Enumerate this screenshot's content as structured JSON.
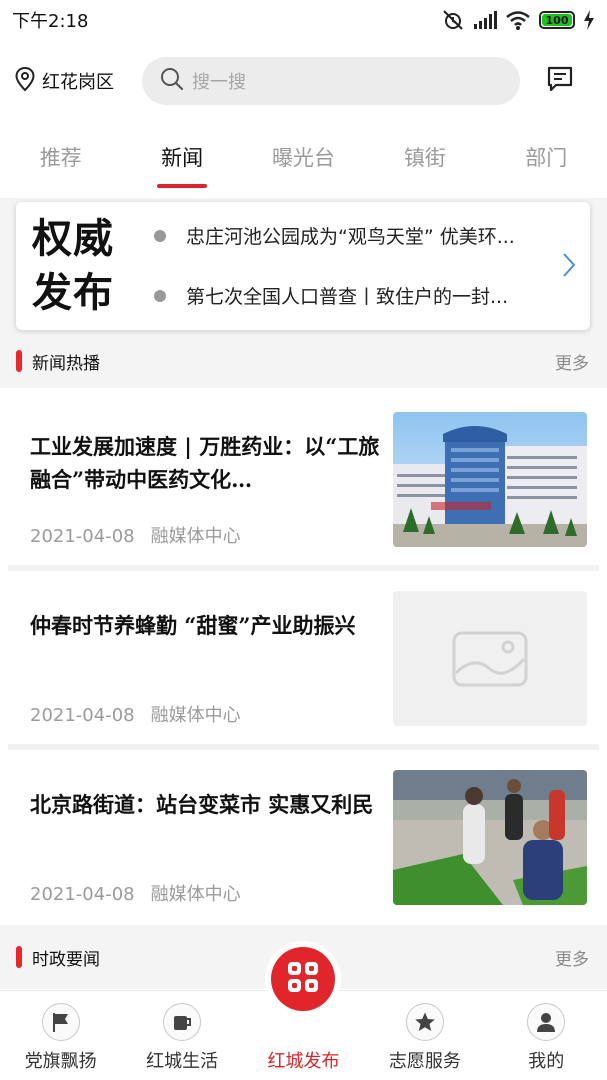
{
  "status_bar": {
    "time": "下午2:18",
    "battery": "100"
  },
  "header": {
    "location": "红花岗区",
    "search_placeholder": "搜一搜"
  },
  "tabs": [
    {
      "label": "推荐"
    },
    {
      "label": "新闻"
    },
    {
      "label": "曝光台"
    },
    {
      "label": "镇街"
    },
    {
      "label": "部门"
    }
  ],
  "active_tab": "新闻",
  "authority": {
    "title_line1": "权威",
    "title_line2": "发布",
    "items": [
      {
        "text": "忠庄河池公园成为“观鸟天堂” 优美环..."
      },
      {
        "text": "第七次全国人口普查丨致住户的一封..."
      }
    ]
  },
  "section_hot": {
    "title": "新闻热播",
    "more": "更多"
  },
  "news": [
    {
      "title": "工业发展加速度 | 万胜药业：以“工旅融合”带动中医药文化…",
      "date": "2021-04-08",
      "source": "融媒体中心"
    },
    {
      "title": "仲春时节养蜂勤 “甜蜜”产业助振兴",
      "date": "2021-04-08",
      "source": "融媒体中心"
    },
    {
      "title": "北京路街道：站台变菜市 实惠又利民",
      "date": "2021-04-08",
      "source": "融媒体中心"
    }
  ],
  "section_politics": {
    "title": "时政要闻",
    "more": "更多"
  },
  "bottom_nav": [
    {
      "label": "党旗飘扬",
      "icon": "flag-icon"
    },
    {
      "label": "红城生活",
      "icon": "cup-icon"
    },
    {
      "label": "红城发布",
      "icon": "grid-icon"
    },
    {
      "label": "志愿服务",
      "icon": "star-icon"
    },
    {
      "label": "我的",
      "icon": "user-icon"
    }
  ],
  "colors": {
    "accent": "#d9252b",
    "battery": "#1ec21e"
  }
}
